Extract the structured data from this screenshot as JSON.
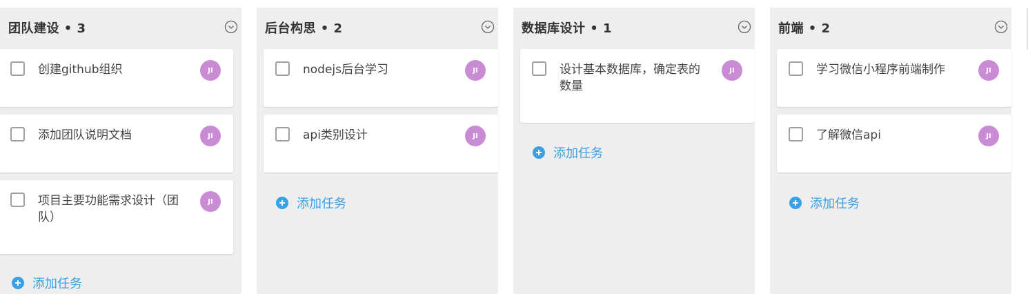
{
  "columns": [
    {
      "title": "团队建设 • 3",
      "tasks": [
        {
          "text": "创建github组织",
          "assignee": "JI"
        },
        {
          "text": "添加团队说明文档",
          "assignee": "JI"
        },
        {
          "text": "项目主要功能需求设计（团队）",
          "assignee": "JI"
        }
      ],
      "add_label": "添加任务"
    },
    {
      "title": "后台构思 • 2",
      "tasks": [
        {
          "text": "nodejs后台学习",
          "assignee": "JI"
        },
        {
          "text": "api类别设计",
          "assignee": "JI"
        }
      ],
      "add_label": "添加任务"
    },
    {
      "title": "数据库设计 • 1",
      "tasks": [
        {
          "text": "设计基本数据库，确定表的数量",
          "assignee": "JI"
        }
      ],
      "add_label": "添加任务"
    },
    {
      "title": "前端 • 2",
      "tasks": [
        {
          "text": "学习微信小程序前端制作",
          "assignee": "JI"
        },
        {
          "text": "了解微信api",
          "assignee": "JI"
        }
      ],
      "add_label": "添加任务"
    }
  ],
  "icons": {
    "column_menu": "chevron-down-circle-icon",
    "add_task": "plus-circle-icon"
  },
  "colors": {
    "accent": "#3aa0e3",
    "avatar": "#c98bd4",
    "column_bg": "#eeeeee"
  }
}
